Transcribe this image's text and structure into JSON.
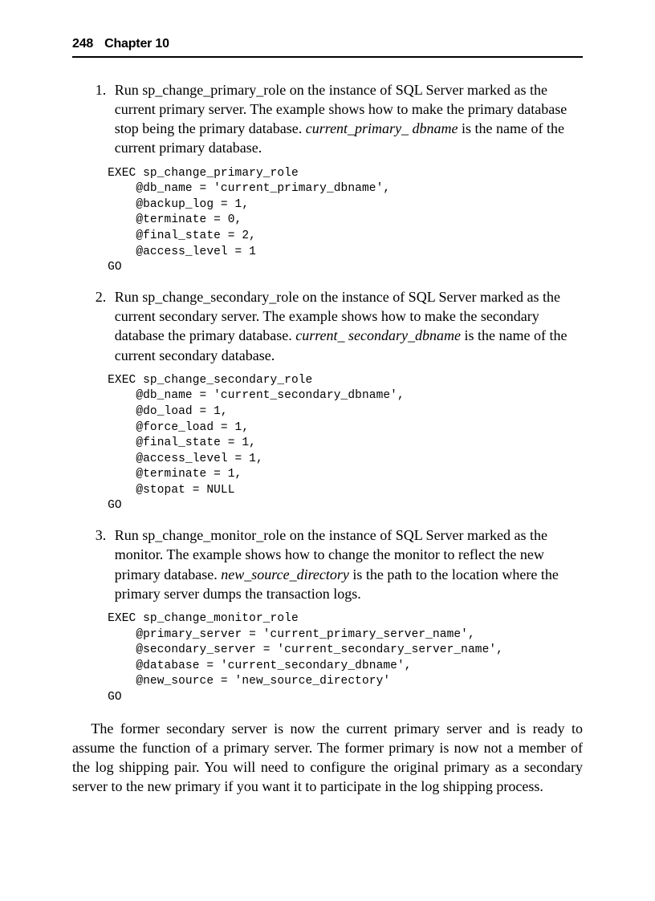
{
  "header": {
    "page_number": "248",
    "chapter_label": "Chapter 10"
  },
  "steps": [
    {
      "text_pre": "Run sp_change_primary_role on the instance of SQL Server marked as the current primary server. The example shows how to make the primary database stop being the primary database. ",
      "text_em": "current_primary_ dbname",
      "text_post": " is the name of the current primary database.",
      "code": "EXEC sp_change_primary_role\n    @db_name = 'current_primary_dbname',\n    @backup_log = 1,\n    @terminate = 0,\n    @final_state = 2,\n    @access_level = 1\nGO"
    },
    {
      "text_pre": "Run sp_change_secondary_role on the instance of SQL Server marked as the current secondary server. The example shows how to make the secondary database the primary database. ",
      "text_em": "current_ secondary_dbname",
      "text_post": " is the name of the current secondary database.",
      "code": "EXEC sp_change_secondary_role\n    @db_name = 'current_secondary_dbname',\n    @do_load = 1,\n    @force_load = 1,\n    @final_state = 1,\n    @access_level = 1,\n    @terminate = 1,\n    @stopat = NULL\nGO"
    },
    {
      "text_pre": "Run sp_change_monitor_role on the instance of SQL Server marked as the monitor. The example shows how to change the monitor to reflect the new primary database. ",
      "text_em": "new_source_directory",
      "text_post": " is the path to the location where the primary server dumps the transaction logs.",
      "code": "EXEC sp_change_monitor_role\n    @primary_server = 'current_primary_server_name',\n    @secondary_server = 'current_secondary_server_name',\n    @database = 'current_secondary_dbname',\n    @new_source = 'new_source_directory'\nGO"
    }
  ],
  "closing_paragraph": "The former secondary server is now the current primary server and is ready to assume the function of a primary server. The former primary is now not a member of the log shipping pair. You will need to configure the original primary as a secondary server to the new primary if you want it to participate in the log shipping process."
}
